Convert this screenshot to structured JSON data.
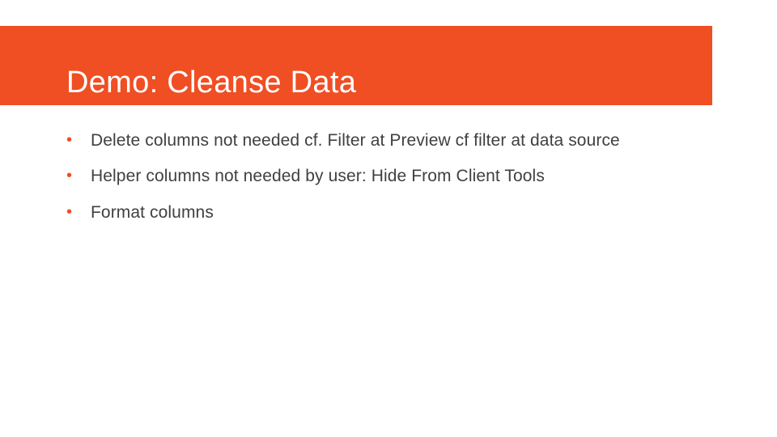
{
  "colors": {
    "accent": "#f04e23",
    "text": "#404040",
    "title": "#ffffff"
  },
  "title": "Demo: Cleanse Data",
  "bullets": [
    {
      "text": "Delete columns not needed cf. Filter at Preview cf filter at data source"
    },
    {
      "text": "Helper columns not needed by user: Hide From Client Tools"
    },
    {
      "text": "Format columns"
    }
  ]
}
